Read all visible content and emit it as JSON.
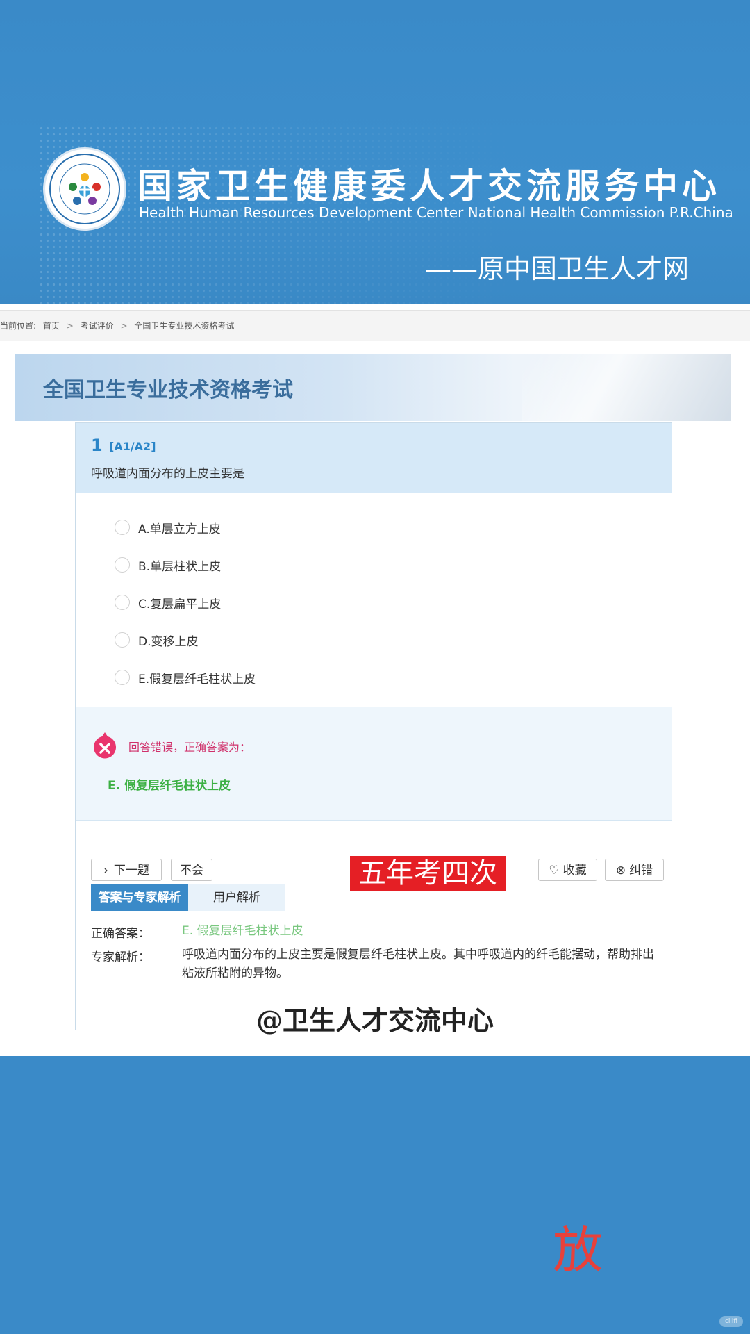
{
  "banner": {
    "org_cn": "国家卫生健康委人才交流服务中心",
    "org_en": "Health Human Resources Development Center National Health Commission P.R.China",
    "org_old": "——原中国卫生人才网"
  },
  "breadcrumb": {
    "label": "当前位置:",
    "items": [
      "首页",
      "考试评价",
      "全国卫生专业技术资格考试"
    ],
    "separator": ">"
  },
  "exam_title": "全国卫生专业技术资格考试",
  "question": {
    "number": "1",
    "type": "[A1/A2]",
    "text": "呼吸道内面分布的上皮主要是",
    "options": [
      "A.单层立方上皮",
      "B.单层柱状上皮",
      "C.复层扁平上皮",
      "D.变移上皮",
      "E.假复层纤毛柱状上皮"
    ]
  },
  "feedback": {
    "status": "回答错误，正确答案为：",
    "correct": "E. 假复层纤毛柱状上皮",
    "icon": "x-circle-icon"
  },
  "actions": {
    "next": "下一题",
    "unknown": "不会",
    "favorite": "收藏",
    "report": "纠错"
  },
  "analysis": {
    "tab_active": "答案与专家解析",
    "tab_inactive": "用户解析",
    "answer_label": "正确答案：",
    "answer_value": "E. 假复层纤毛柱状上皮",
    "expert_label": "专家解析：",
    "expert_text": "呼吸道内面分布的上皮主要是假复层纤毛柱状上皮。其中呼吸道内的纤毛能摆动，帮助排出粘液所粘附的异物。"
  },
  "overlay": {
    "sticker": "五年考四次",
    "watermark": "@卫生人才交流中心",
    "red_char": "放",
    "corner_mark": "cliifi"
  },
  "colors": {
    "brand_blue": "#3a8ac8",
    "error_pink": "#d0316b",
    "correct_green": "#3cb043",
    "sticker_red": "#e51f25"
  }
}
